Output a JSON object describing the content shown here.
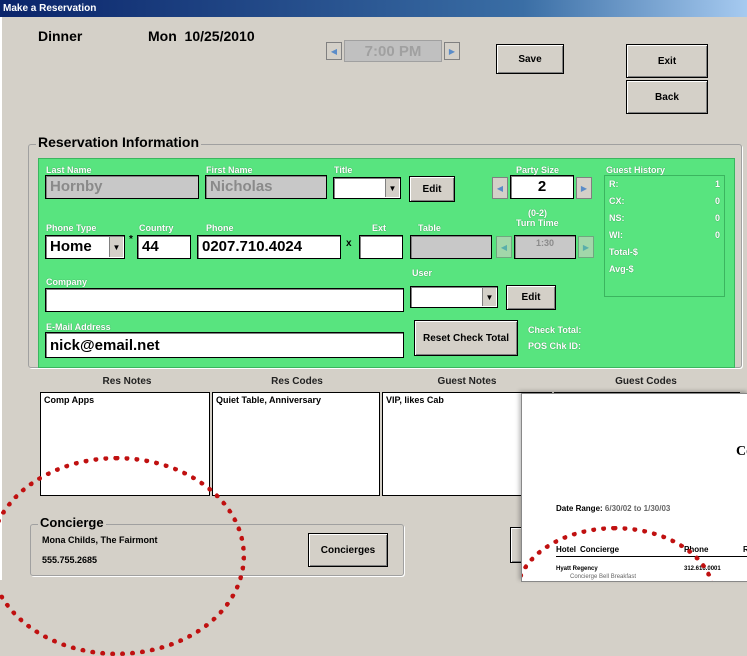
{
  "window": {
    "title": "Make a Reservation"
  },
  "header": {
    "meal": "Dinner",
    "date": "Mon  10/25/2010",
    "time": "7:00 PM",
    "save_label": "Save",
    "exit_label": "Exit",
    "back_label": "Back"
  },
  "res_info": {
    "section_title": "Reservation Information",
    "last_name_label": "Last Name",
    "last_name_value": "Hornby",
    "first_name_label": "First Name",
    "first_name_value": "Nicholas",
    "title_label": "Title",
    "title_value": "",
    "title_edit_label": "Edit",
    "party_size_label": "Party Size",
    "party_size_value": "2",
    "party_size_range": "(0-2)",
    "turn_time_label": "Turn Time",
    "turn_time_value": "1:30",
    "phone_type_label": "Phone Type",
    "phone_type_value": "Home",
    "country_label": "Country",
    "country_value": "44",
    "phone_label": "Phone",
    "phone_value": "0207.710.4024",
    "ext_label": "Ext",
    "ext_value": "",
    "table_label": "Table",
    "table_value": "",
    "company_label": "Company",
    "company_value": "",
    "user_label": "User",
    "user_value": "",
    "user_edit_label": "Edit",
    "email_label": "E-Mail Address",
    "email_value": "nick@email.net",
    "reset_check_label": "Reset Check Total",
    "check_total_label": "Check Total:",
    "pos_chk_label": "POS Chk ID:",
    "required_mark": "*",
    "ext_mark": "x"
  },
  "guest_history": {
    "title": "Guest History",
    "rows": [
      {
        "label": "R:",
        "value": "1"
      },
      {
        "label": "CX:",
        "value": "0"
      },
      {
        "label": "NS:",
        "value": "0"
      },
      {
        "label": "WI:",
        "value": "0"
      },
      {
        "label": "Total-$",
        "value": ""
      },
      {
        "label": "Avg-$",
        "value": ""
      }
    ]
  },
  "notes": {
    "res_notes_label": "Res Notes",
    "res_notes_value": "Comp Apps",
    "res_codes_label": "Res Codes",
    "res_codes_value": "Quiet Table, Anniversary",
    "guest_notes_label": "Guest Notes",
    "guest_notes_value": "VIP, likes Cab",
    "guest_codes_label": "Guest Codes",
    "guest_codes_value": ""
  },
  "concierge": {
    "title": "Concierge",
    "name": "Mona Childs, The Fairmont",
    "phone": "555.755.2685",
    "button_label": "Concierges"
  },
  "report_overlay": {
    "title": "Conci",
    "date_range_label": "Date Range:",
    "date_range_from": "6/30/02",
    "date_range_to_word": "to",
    "date_range_to": "1/30/03",
    "col_hotel": "Hotel",
    "col_concierge": "Concierge",
    "col_phone": "Phone",
    "col_ro": "Ro",
    "row1_hotel": "Hyatt Regency",
    "row1_phone": "312.616.0001",
    "row1_sub": "Concierge Bell Breakfast"
  },
  "icons": {
    "arrow_left": "left-arrow-icon",
    "arrow_right": "right-arrow-icon",
    "dropdown": "chevron-down-icon"
  },
  "colors": {
    "green_panel": "#58e47f",
    "titlebar": "#0a246a",
    "highlight_dots": "#c01010"
  }
}
